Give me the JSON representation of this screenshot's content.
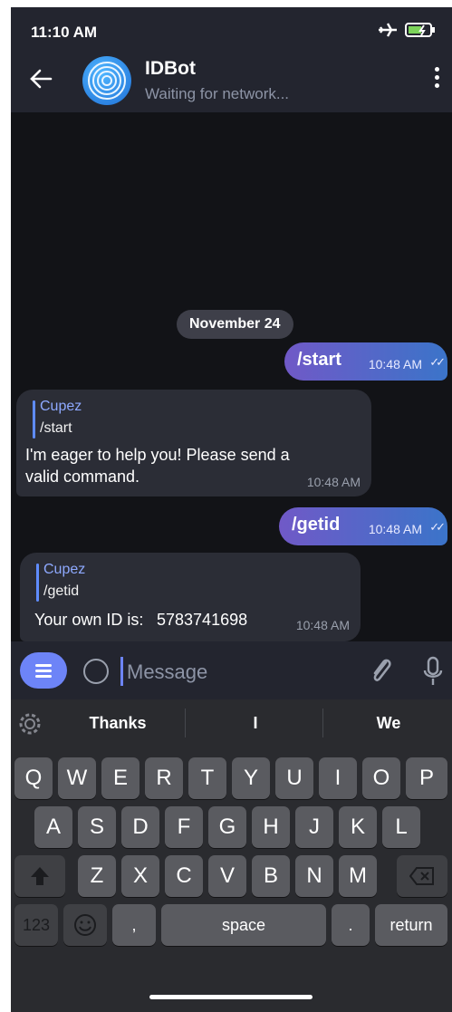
{
  "status_bar": {
    "time": "11:10 AM"
  },
  "chat": {
    "title": "IDBot",
    "status": "Waiting for network..."
  },
  "date_chip": "November 24",
  "messages": [
    {
      "dir": "out",
      "text": "/start",
      "time": "10:48 AM"
    },
    {
      "dir": "in",
      "reply_name": "Cupez",
      "reply_text": "/start",
      "text_line1": "I'm eager to help you! Please send a",
      "text_line2": "valid command.",
      "time": "10:48 AM"
    },
    {
      "dir": "out",
      "text": "/getid",
      "time": "10:48 AM"
    },
    {
      "dir": "in",
      "reply_name": "Cupez",
      "reply_text": "/getid",
      "text_label": "Your own ID is:",
      "text_value": "5783741698",
      "time": "10:48 AM"
    }
  ],
  "input": {
    "placeholder": "Message"
  },
  "keyboard": {
    "suggestions": [
      "Thanks",
      "I",
      "We"
    ],
    "row1": [
      "Q",
      "W",
      "E",
      "R",
      "T",
      "Y",
      "U",
      "I",
      "O",
      "P"
    ],
    "row2": [
      "A",
      "S",
      "D",
      "F",
      "G",
      "H",
      "J",
      "K",
      "L"
    ],
    "row3": [
      "Z",
      "X",
      "C",
      "V",
      "B",
      "N",
      "M"
    ],
    "numbers_key": "123",
    "comma_key": ",",
    "space_key": "space",
    "period_key": ".",
    "return_key": "return"
  },
  "icons": [
    "airplane-icon",
    "battery-icon",
    "back-arrow-icon",
    "fingerprint-icon",
    "more-vert-icon",
    "menu-icon",
    "emoji-icon",
    "attach-icon",
    "mic-icon",
    "gear-icon",
    "shift-icon",
    "backspace-icon",
    "emoji-key-icon"
  ]
}
